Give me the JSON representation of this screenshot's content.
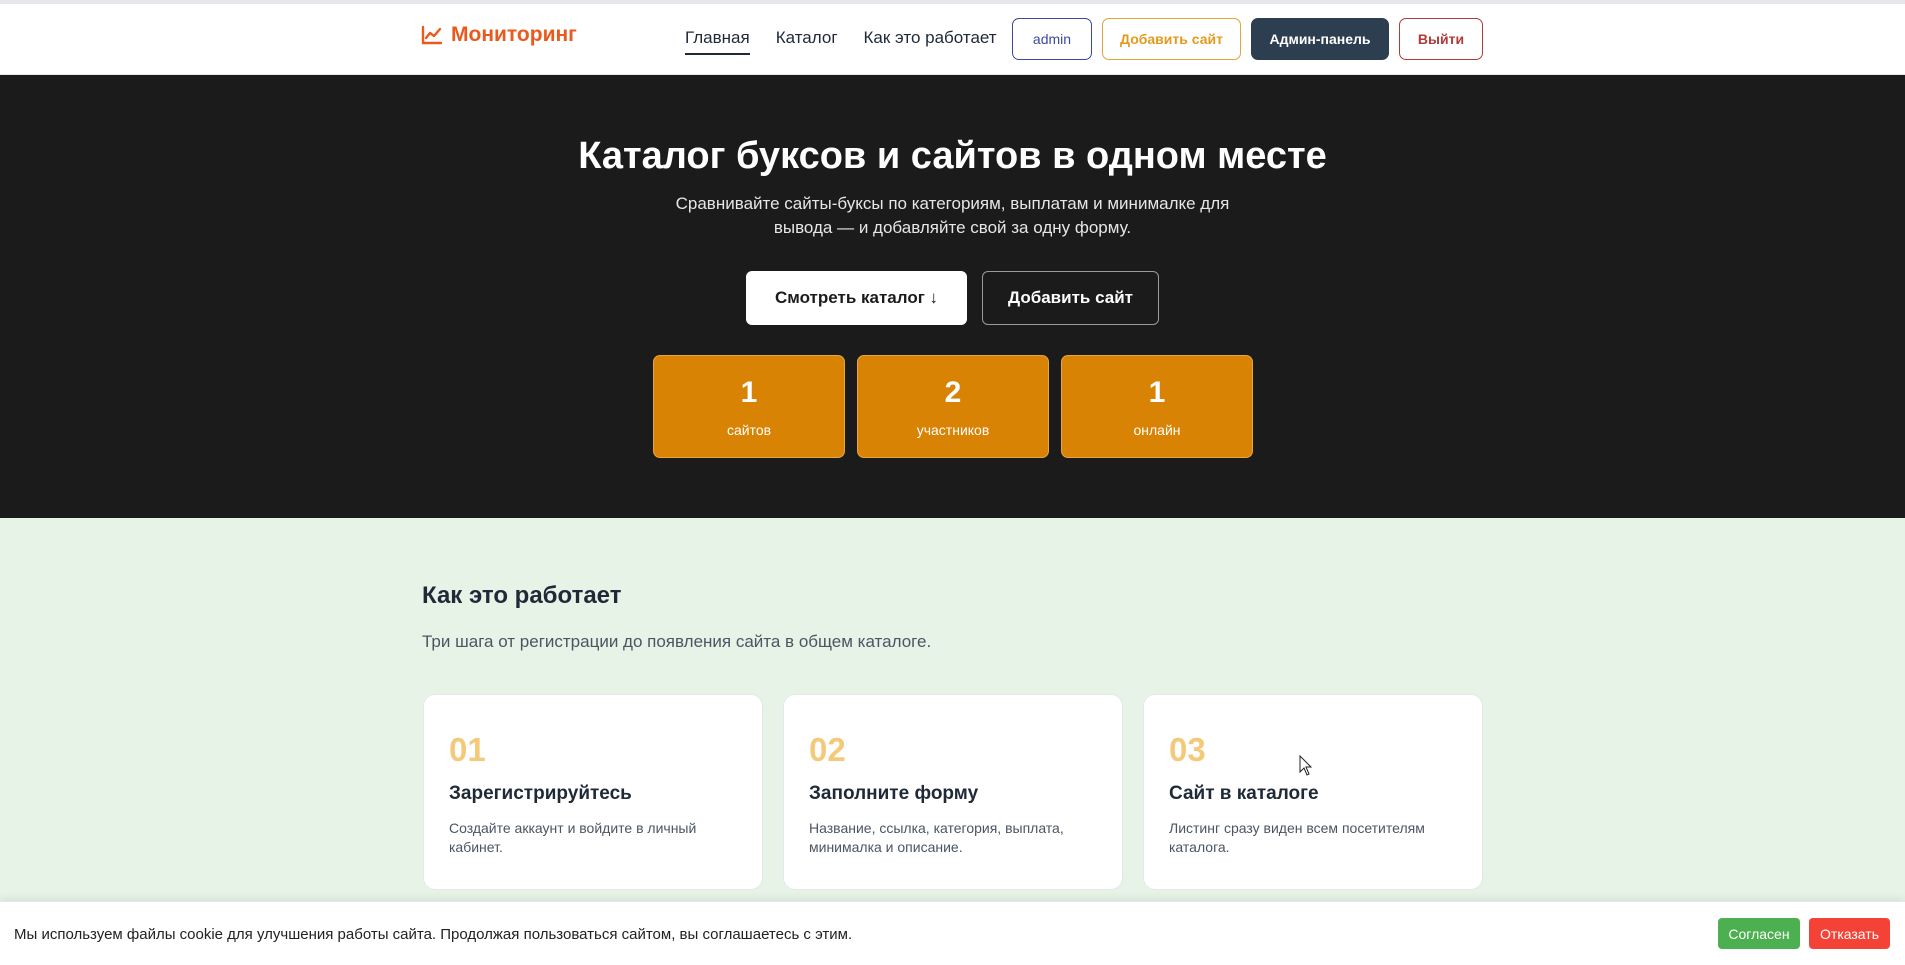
{
  "header": {
    "logo_text": "Мониторинг",
    "logo_icon": "chart-line-icon",
    "nav": [
      {
        "label": "Главная",
        "active": true
      },
      {
        "label": "Каталог",
        "active": false
      },
      {
        "label": "Как это работает",
        "active": false
      }
    ],
    "user_label": "admin",
    "add_site_label": "Добавить сайт",
    "admin_panel_label": "Админ-панель",
    "logout_label": "Выйти"
  },
  "hero": {
    "title": "Каталог буксов и сайтов в одном месте",
    "subtitle": "Сравнивайте сайты-буксы по категориям, выплатам и минималке для вывода — и добавляйте свой за одну форму.",
    "cta_catalog": "Смотреть каталог ↓",
    "cta_add": "Добавить сайт",
    "stats": [
      {
        "value": "1",
        "label": "сайтов"
      },
      {
        "value": "2",
        "label": "участников"
      },
      {
        "value": "1",
        "label": "онлайн"
      }
    ]
  },
  "how": {
    "title": "Как это работает",
    "subtitle": "Три шага от регистрации до появления сайта в общем каталоге.",
    "steps": [
      {
        "num": "01",
        "title": "Зарегистрируйтесь",
        "desc": "Создайте аккаунт и войдите в личный кабинет."
      },
      {
        "num": "02",
        "title": "Заполните форму",
        "desc": "Название, ссылка, категория, выплата, минималка и описание."
      },
      {
        "num": "03",
        "title": "Сайт в каталоге",
        "desc": "Листинг сразу виден всем посетителям каталога."
      }
    ]
  },
  "cookie": {
    "text": "Мы используем файлы cookie для улучшения работы сайта. Продолжая пользоваться сайтом, вы соглашаетесь с этим.",
    "accept_label": "Согласен",
    "decline_label": "Отказать"
  },
  "colors": {
    "accent": "#ea5a1e",
    "stat_bg": "#d98304",
    "hero_bg": "#1b1b1b",
    "section_bg": "#e6f3e6"
  }
}
